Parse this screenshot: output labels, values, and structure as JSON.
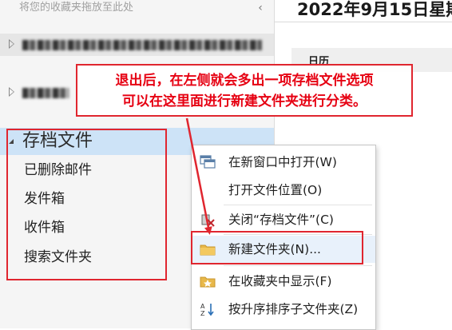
{
  "nav": {
    "favorites_hint": "将您的收藏夹拖放至此处",
    "collapse_glyph": "‹",
    "archive_folder": {
      "title": "存档文件",
      "children": [
        "已删除邮件",
        "发件箱",
        "收件箱",
        "搜索文件夹"
      ]
    }
  },
  "reading_pane": {
    "date_heading": "2022年9月15日星期",
    "calendar_label": "日历"
  },
  "callout": {
    "line1": "退出后，在左侧就会多出一项存档文件选项",
    "line2": "可以在这里面进行新建文件夹进行分类。"
  },
  "context_menu": {
    "items": [
      {
        "label": "在新窗口中打开(W)",
        "icon": "new-window-icon"
      },
      {
        "label": "打开文件位置(O)",
        "icon": ""
      },
      {
        "label": "关闭“存档文件”(C)",
        "icon": "close-data-file-icon"
      },
      {
        "label": "新建文件夹(N)...",
        "icon": "folder-icon"
      },
      {
        "label": "在收藏夹中显示(F)",
        "icon": "favorite-folder-icon"
      },
      {
        "label": "按升序排序子文件夹(Z)",
        "icon": "sort-az-icon"
      }
    ]
  },
  "colors": {
    "annotation_red": "#e0262f",
    "selection_blue": "#cde3f7"
  }
}
